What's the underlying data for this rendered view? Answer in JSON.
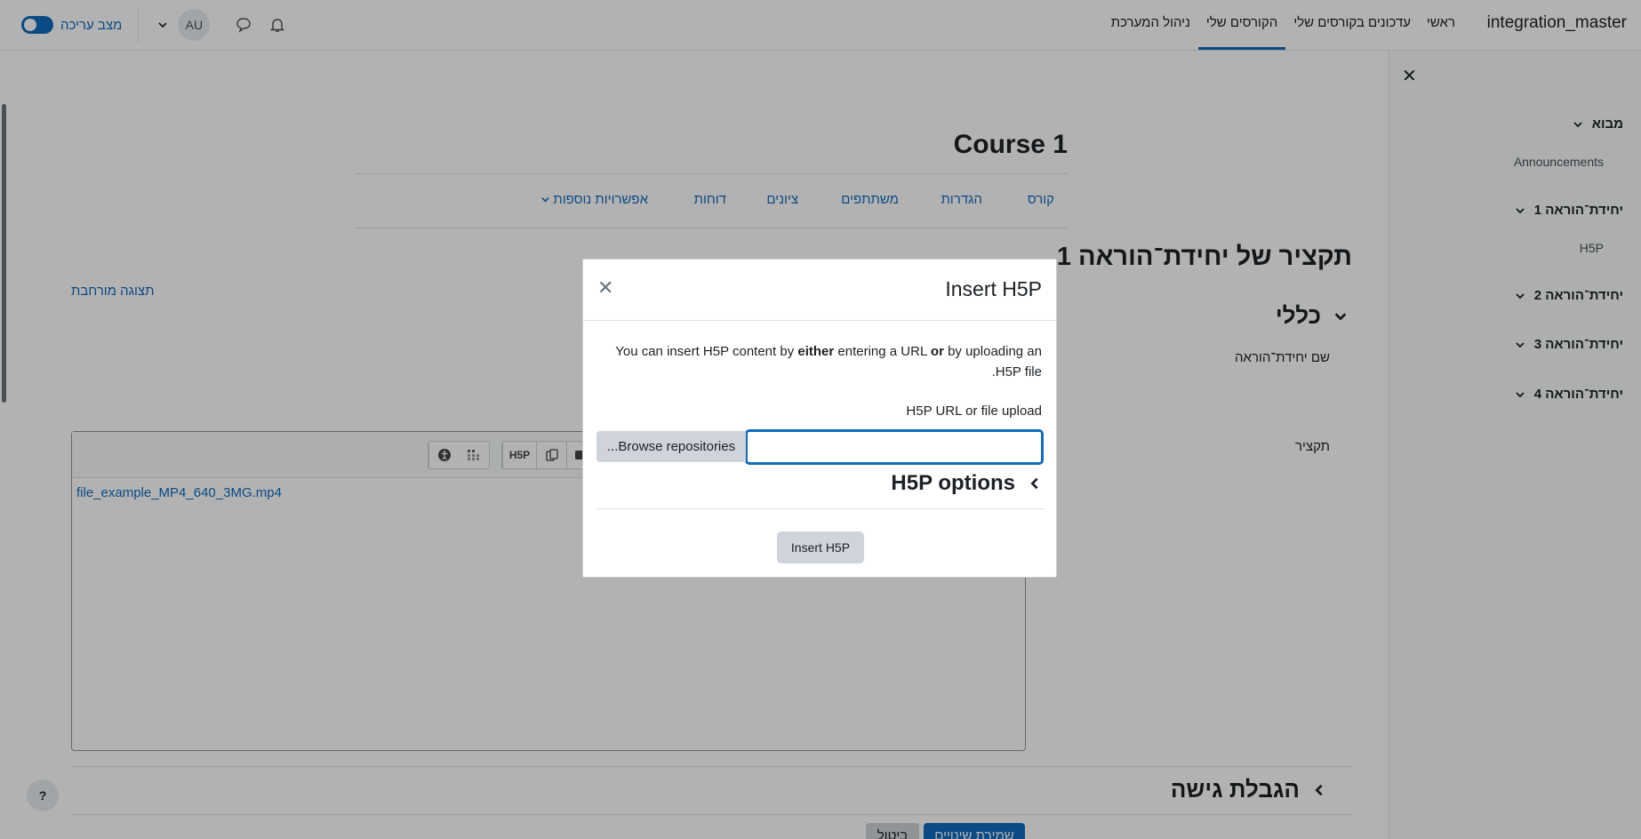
{
  "navbar": {
    "brand": "integration_master",
    "items": [
      {
        "label": "ראשי",
        "active": false
      },
      {
        "label": "עדכונים בקורסים שלי",
        "active": false
      },
      {
        "label": "הקורסים שלי",
        "active": true
      },
      {
        "label": "ניהול המערכת",
        "active": false
      }
    ],
    "edit_mode_label": "מצב עריכה",
    "avatar_initials": "AU"
  },
  "drawer": {
    "sections": [
      {
        "label": "מבוא",
        "activity": "Announcements"
      },
      {
        "label": "יחידת־הוראה 1",
        "activity": "H5P"
      },
      {
        "label": "יחידת־הוראה 2"
      },
      {
        "label": "יחידת־הוראה 3"
      },
      {
        "label": "יחידת־הוראה 4"
      }
    ]
  },
  "course": {
    "title": "Course 1",
    "secondary_nav": [
      "קורס",
      "הגדרות",
      "משתתפים",
      "ציונים",
      "דוחות",
      "אפשרויות נוספות"
    ]
  },
  "page": {
    "heading": "תקציר של יחידת־הוראה 1",
    "expand_all": "תצוגה מורחבת",
    "general_section": "כללי",
    "field_section_name": "שם יחידת־הוראה",
    "field_summary": "תקציר",
    "editor_content_link": "file_example_MP4_640_3MG.mp4",
    "restrict_section": "הגבלת גישה",
    "save_button": "שמירת שינויים",
    "cancel_button": "ביטול",
    "help_button": "?"
  },
  "editor_toolbar": {
    "h5p_button": "H5P"
  },
  "modal": {
    "title": "Insert H5P",
    "desc_1": "You can insert H5P content by ",
    "desc_bold_1": "either",
    "desc_2": " entering a URL ",
    "desc_bold_2": "or",
    "desc_3": " by uploading an H5P file.",
    "upload_label": "H5P URL or file upload",
    "url_value": "",
    "browse_button": "Browse repositories...",
    "options_heading": "H5P options",
    "insert_button": "Insert H5P"
  },
  "colors": {
    "accent": "#0f6cbf",
    "text": "#1d2125",
    "muted_button": "#ced4da"
  }
}
